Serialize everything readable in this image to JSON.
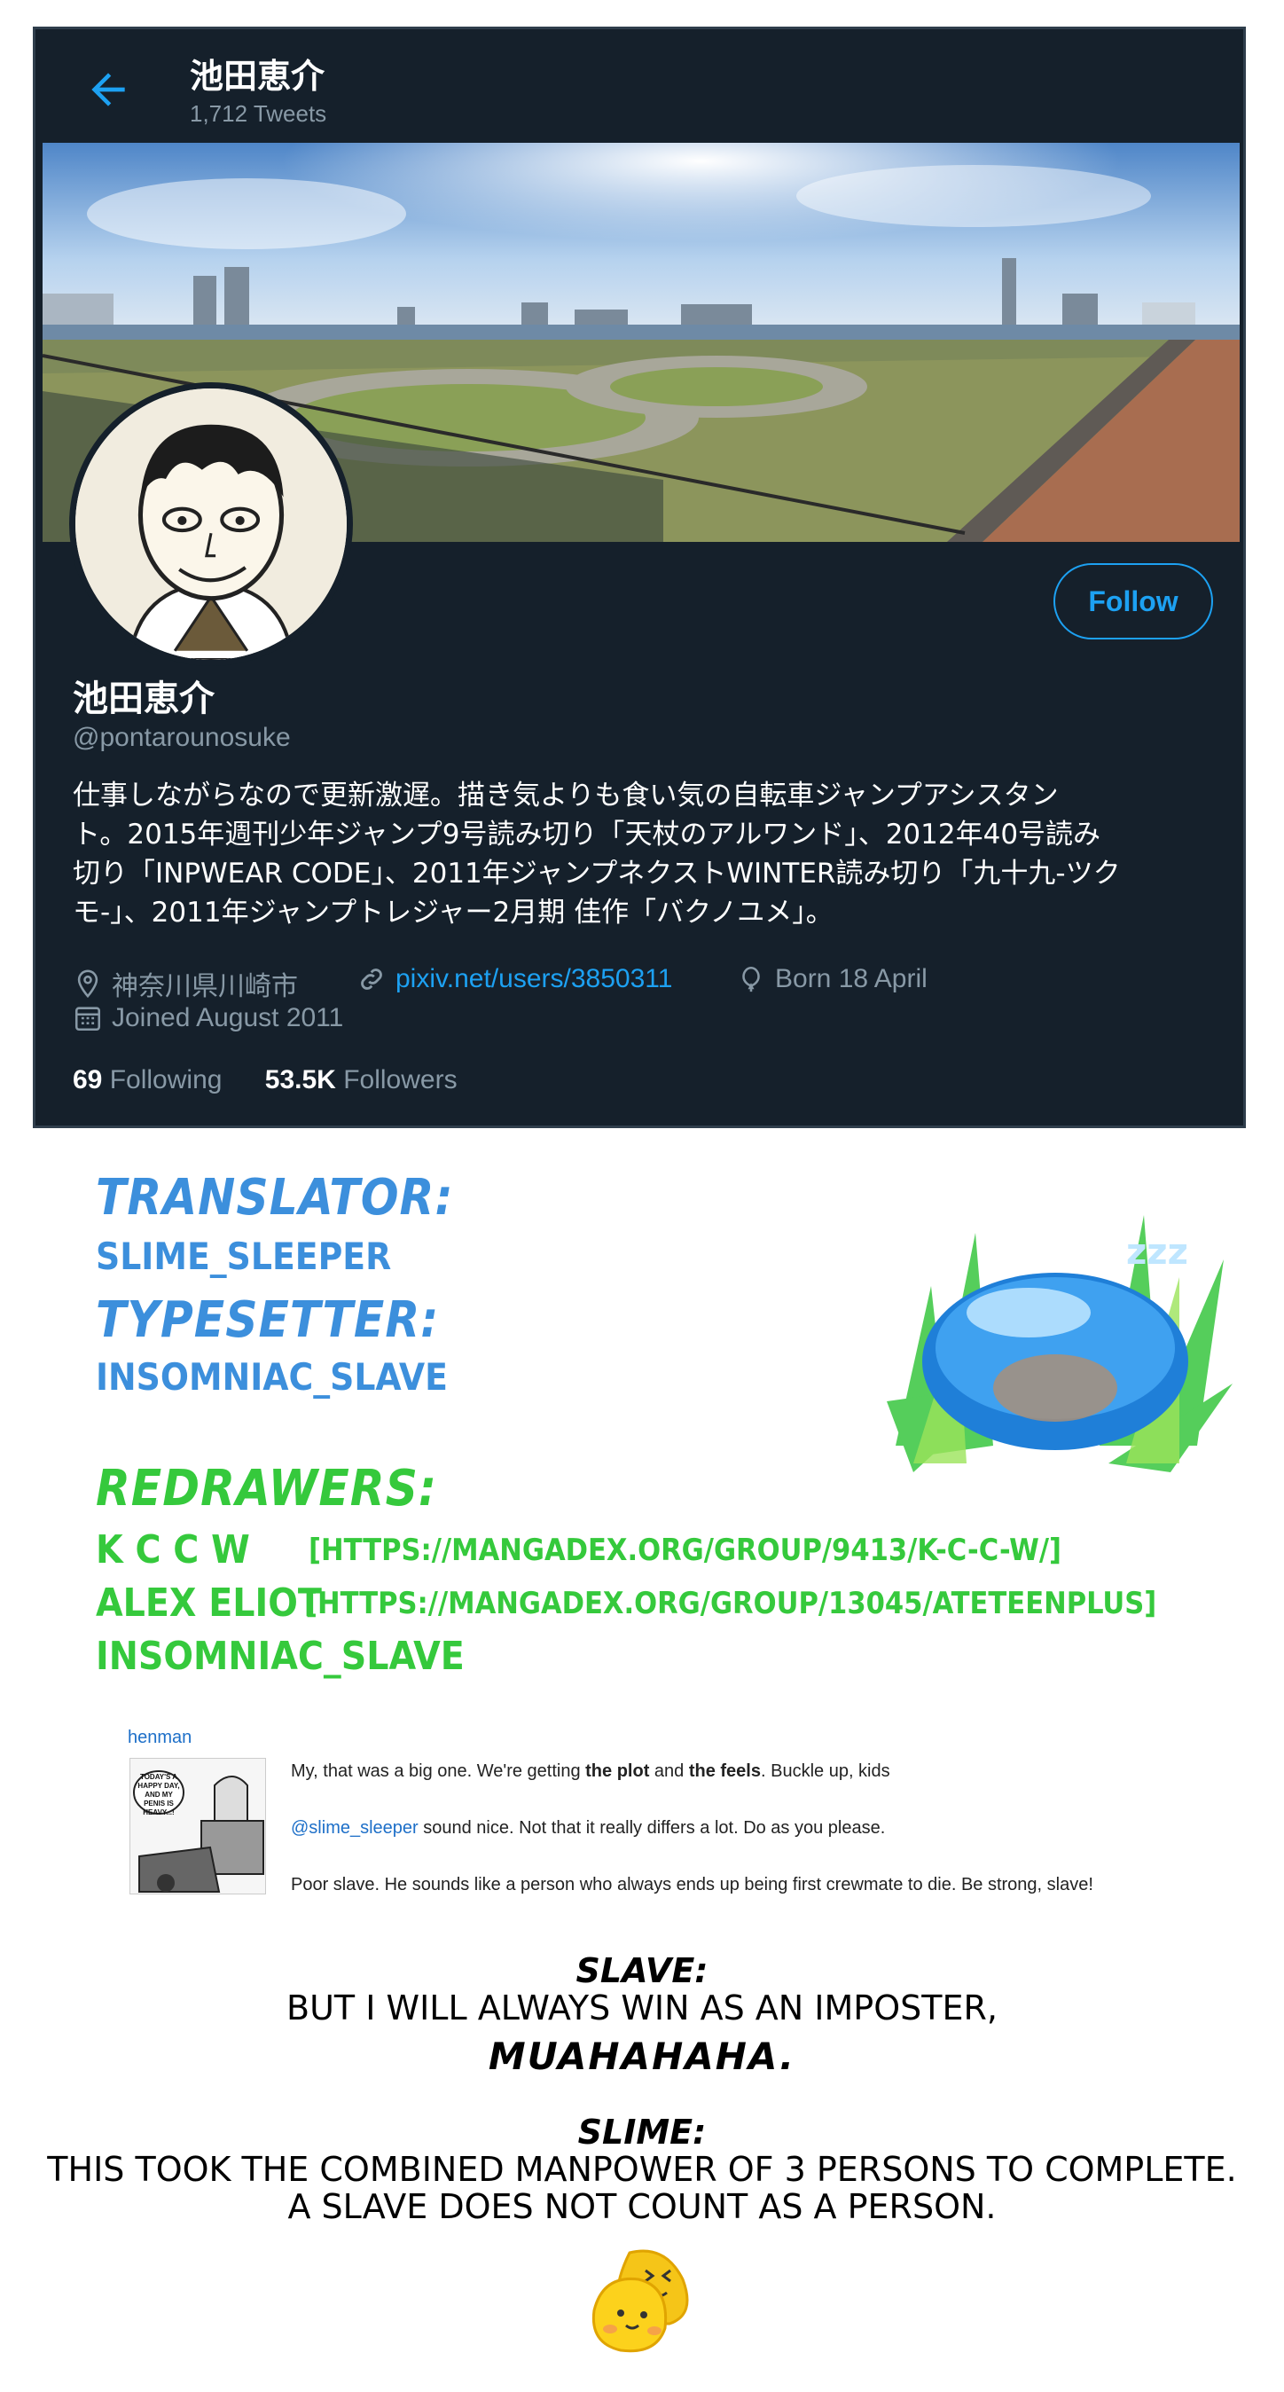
{
  "profile": {
    "header_name": "池田恵介",
    "tweet_count": "1,712 Tweets",
    "name": "池田恵介",
    "handle": "@pontarounosuke",
    "bio_lines": [
      "仕事しながらなので更新激遅。描き気よりも食い気の自転車ジャンプアシスタン",
      "ト。2015年週刊少年ジャンプ9号読み切り「天杖のアルワンド」、2012年40号読み",
      "切り「INPWEAR CODE」、2011年ジャンプネクストWINTER読み切り「九十九-ツク",
      "モ-」、2011年ジャンプトレジャー2月期 佳作「バクノユメ」。"
    ],
    "location": "神奈川県川崎市",
    "website": "pixiv.net/users/3850311",
    "birthday": "Born 18 April",
    "joined": "Joined August 2011",
    "following_count": "69",
    "following_label": "Following",
    "followers_count": "53.5K",
    "followers_label": "Followers",
    "follow_button": "Follow",
    "accent_color": "#1da1f2",
    "icons": [
      "back-arrow-icon",
      "location-pin-icon",
      "link-icon",
      "balloon-icon",
      "calendar-icon"
    ]
  },
  "credits": {
    "translator_label": "Translator:",
    "translator": "Slime_Sleeper",
    "typesetter_label": "Typesetter:",
    "typesetter": "Insomniac_Slave",
    "redrawers_label": "Redrawers:",
    "redrawers": [
      {
        "name": "K C C W",
        "link": "[https://mangadex.org/group/9413/k-c-c-w/]"
      },
      {
        "name": "Alex Eliot",
        "link": "[https://mangadex.org/group/13045/ateteenplus]"
      },
      {
        "name": "Insomniac_Slave",
        "link": ""
      }
    ],
    "blue_color": "#3c8fdc",
    "green_color": "#35c93c"
  },
  "comment": {
    "user": "henman",
    "thumb_caption": "TODAY'S A HAPPY DAY, AND MY PENIS IS HEAVY...!",
    "line1_a": "My, that was a big one. We're getting ",
    "line1_b": "the plot",
    "line1_c": " and ",
    "line1_d": "the feels",
    "line1_e": ". Buckle up, kids",
    "line2_mention": "@slime_sleeper",
    "line2_rest": " sound nice. Not that it really differs a lot. Do as you please.",
    "line3": "Poor slave. He sounds like a person who always ends up being first crewmate to die. Be strong, slave!"
  },
  "notes": {
    "slave_label": "Slave:",
    "slave_line": "But I will always win as an imposter,",
    "slave_laugh": "Muahahaha.",
    "slime_label": "Slime:",
    "slime_line1": "This took the combined manpower of 3 persons to complete.",
    "slime_line2": "A slave does not count as a person."
  }
}
